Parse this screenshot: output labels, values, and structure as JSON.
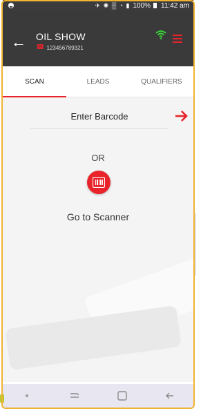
{
  "status_bar": {
    "icons": "✈ ✺ ▒ ◔ ▮",
    "battery": "100%",
    "time": "11:42 am"
  },
  "header": {
    "title": "OIL SHOW",
    "phone": "123456789321",
    "accent_color": "#e8232a",
    "wifi_color": "#3bd13b"
  },
  "tabs": [
    {
      "label": "SCAN",
      "active": true
    },
    {
      "label": "LEADS",
      "active": false
    },
    {
      "label": "QUALIFIERS",
      "active": false
    }
  ],
  "scan": {
    "barcode_placeholder": "Enter Barcode",
    "or_text": "OR",
    "scanner_label": "Go to Scanner"
  },
  "nav": {
    "recent_icon": "recent-apps-icon",
    "home_icon": "home-icon",
    "back_icon": "back-icon"
  }
}
